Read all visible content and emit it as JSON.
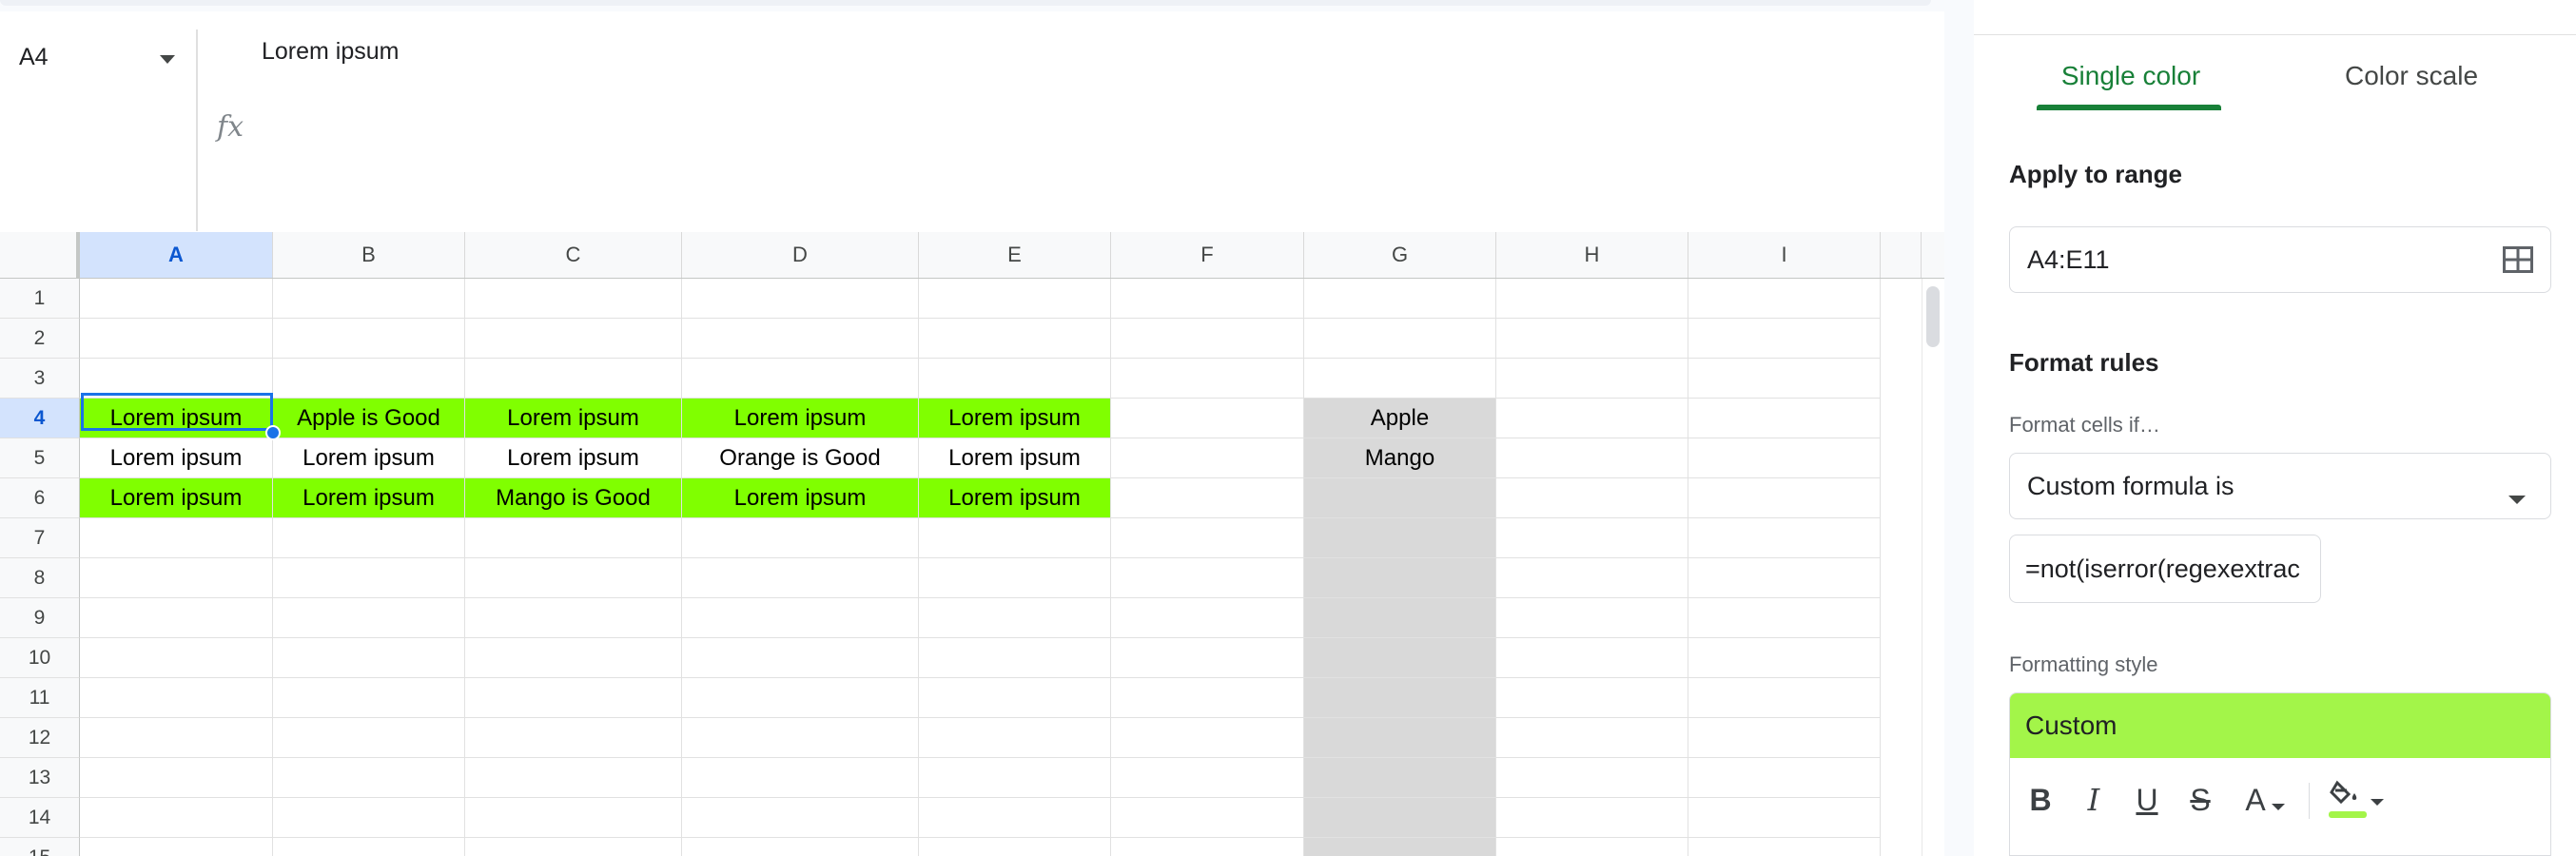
{
  "formula_bar": {
    "cell_ref": "A4",
    "fx_label": "fx",
    "content": "Lorem ipsum"
  },
  "grid": {
    "columns": [
      "A",
      "B",
      "C",
      "D",
      "E",
      "F",
      "G",
      "H",
      "I"
    ],
    "active_column": "A",
    "active_row": "4",
    "rows": [
      {
        "num": "1",
        "cells": [
          "",
          "",
          "",
          "",
          "",
          "",
          "",
          "",
          ""
        ]
      },
      {
        "num": "2",
        "cells": [
          "",
          "",
          "",
          "",
          "",
          "",
          "",
          "",
          ""
        ]
      },
      {
        "num": "3",
        "cells": [
          "",
          "",
          "",
          "",
          "",
          "",
          "",
          "",
          ""
        ]
      },
      {
        "num": "4",
        "cells": [
          "Lorem ipsum",
          "Apple is Good",
          "Lorem ipsum",
          "Lorem ipsum",
          "Lorem ipsum",
          "",
          "Apple",
          "",
          ""
        ]
      },
      {
        "num": "5",
        "cells": [
          "Lorem ipsum",
          "Lorem ipsum",
          "Lorem ipsum",
          "Orange is Good",
          "Lorem ipsum",
          "",
          "Mango",
          "",
          ""
        ]
      },
      {
        "num": "6",
        "cells": [
          "Lorem ipsum",
          "Lorem ipsum",
          "Mango is Good",
          "Lorem ipsum",
          "Lorem ipsum",
          "",
          "",
          "",
          ""
        ]
      },
      {
        "num": "7",
        "cells": [
          "",
          "",
          "",
          "",
          "",
          "",
          "",
          "",
          ""
        ]
      },
      {
        "num": "8",
        "cells": [
          "",
          "",
          "",
          "",
          "",
          "",
          "",
          "",
          ""
        ]
      },
      {
        "num": "9",
        "cells": [
          "",
          "",
          "",
          "",
          "",
          "",
          "",
          "",
          ""
        ]
      },
      {
        "num": "10",
        "cells": [
          "",
          "",
          "",
          "",
          "",
          "",
          "",
          "",
          ""
        ]
      },
      {
        "num": "11",
        "cells": [
          "",
          "",
          "",
          "",
          "",
          "",
          "",
          "",
          ""
        ]
      },
      {
        "num": "12",
        "cells": [
          "",
          "",
          "",
          "",
          "",
          "",
          "",
          "",
          ""
        ]
      },
      {
        "num": "13",
        "cells": [
          "",
          "",
          "",
          "",
          "",
          "",
          "",
          "",
          ""
        ]
      },
      {
        "num": "14",
        "cells": [
          "",
          "",
          "",
          "",
          "",
          "",
          "",
          "",
          ""
        ]
      },
      {
        "num": "15",
        "cells": [
          "",
          "",
          "",
          "",
          "",
          "",
          "",
          "",
          ""
        ]
      }
    ],
    "highlighted_rows": [
      "4",
      "6"
    ],
    "highlight_color": "#80ff00",
    "shaded_column": "G",
    "shade_color": "#d9d9d9"
  },
  "panel": {
    "tabs": [
      {
        "label": "Single color",
        "active": true
      },
      {
        "label": "Color scale",
        "active": false
      }
    ],
    "accent_color": "#188038",
    "apply_to_range_label": "Apply to range",
    "range_value": "A4:E11",
    "format_rules_label": "Format rules",
    "format_cells_if_label": "Format cells if…",
    "condition_value": "Custom formula is",
    "formula_value": "=not(iserror(regexextrac",
    "formatting_style_label": "Formatting style",
    "style_preview_label": "Custom",
    "style_fill_color": "#a3f549",
    "tools": {
      "bold": "B",
      "italic": "I",
      "underline": "U",
      "strike": "S",
      "text_color": "A"
    }
  }
}
